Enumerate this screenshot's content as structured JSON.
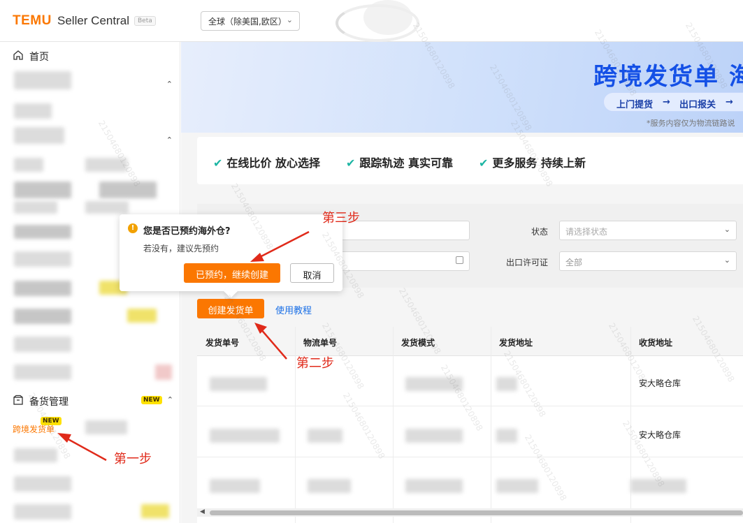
{
  "header": {
    "logo": "TEMU",
    "app_name": "Seller Central",
    "beta": "Beta",
    "region": "全球（除美国,欧区）"
  },
  "sidebar": {
    "home": "首页",
    "stock_management": "备货管理",
    "new_badge": "NEW",
    "cross_border_item": "跨境发货单"
  },
  "banner": {
    "title": "跨境发货单 海",
    "pill_step1": "上门提货",
    "pill_step2": "出口报关",
    "note": "*服务内容仅为物流链路说"
  },
  "features": [
    "在线比价 放心选择",
    "跟踪轨迹 真实可靠",
    "更多服务 持续上新"
  ],
  "filters": {
    "status_label": "状态",
    "status_placeholder": "请选择状态",
    "license_label": "出口许可证",
    "license_value": "全部"
  },
  "actions": {
    "create": "创建发货单",
    "tutorial": "使用教程"
  },
  "table": {
    "headers": [
      "发货单号",
      "物流单号",
      "发货模式",
      "发货地址",
      "收货地址"
    ],
    "rows": [
      {
        "receive_address": "安大略仓库"
      },
      {
        "receive_address": "安大略仓库"
      }
    ]
  },
  "popover": {
    "title": "您是否已预约海外仓?",
    "text": "若没有，建议先预约",
    "confirm": "已预约，继续创建",
    "cancel": "取消"
  },
  "annotations": {
    "step1": "第一步",
    "step2": "第二步",
    "step3": "第三步"
  },
  "watermark": "21504680120898",
  "colors": {
    "brand_orange": "#fb7701",
    "annotation_red": "#e02a1a",
    "banner_blue": "#1450e6",
    "check_teal": "#1cb5a3",
    "link_blue": "#1a6fe6"
  }
}
